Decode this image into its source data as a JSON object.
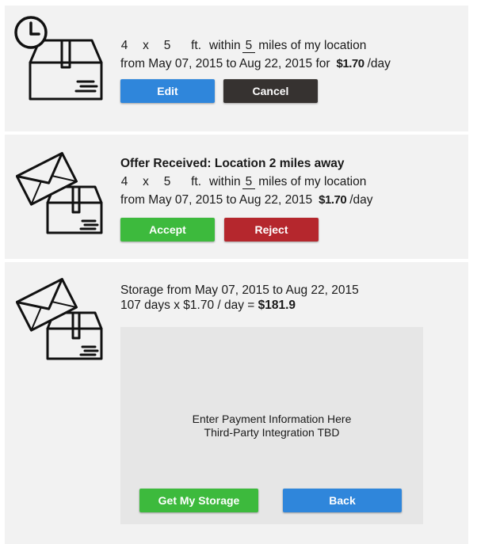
{
  "request": {
    "width": "4",
    "x": "x",
    "length": "5",
    "unit": "ft.",
    "within": "within",
    "miles": "5",
    "miles_suffix": "miles of my location",
    "date_range": "from May 07, 2015 to Aug 22, 2015 for",
    "price": "$1.70",
    "per_day": "/day",
    "edit_label": "Edit",
    "cancel_label": "Cancel",
    "icon": "clock-box-icon"
  },
  "offer": {
    "title": "Offer Received: Location 2 miles away",
    "width": "4",
    "x": "x",
    "length": "5",
    "unit": "ft.",
    "within": "within",
    "miles": "5",
    "miles_suffix": "miles of my location",
    "date_range": "from May 07, 2015 to Aug 22, 2015",
    "price": "$1.70",
    "per_day": "/day",
    "accept_label": "Accept",
    "reject_label": "Reject",
    "icon": "envelope-box-icon"
  },
  "checkout": {
    "storage_line": "Storage from May 07, 2015 to Aug 22, 2015",
    "calc_prefix": "107 days x $1.70 / day =",
    "total": "$181.9",
    "payment_line1": "Enter Payment Information Here",
    "payment_line2": "Third-Party Integration TBD",
    "get_label": "Get My Storage",
    "back_label": "Back",
    "icon": "envelope-box-icon"
  },
  "colors": {
    "blue": "#2f86db",
    "dark": "#363230",
    "green": "#3dba3d",
    "red": "#b5272d",
    "panel": "#f2f2f2",
    "payment_box": "#e6e6e6"
  }
}
